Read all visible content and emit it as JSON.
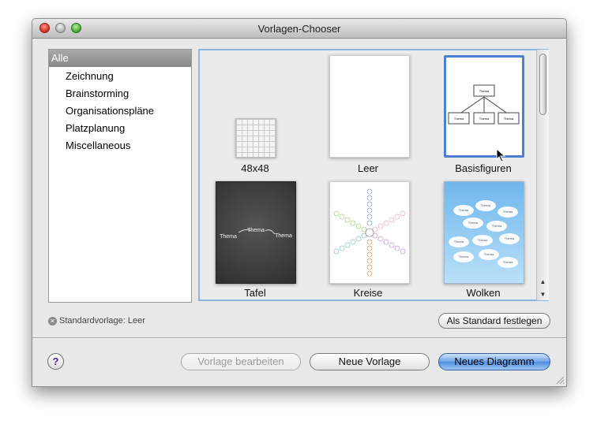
{
  "window": {
    "title": "Vorlagen-Chooser"
  },
  "sidebar": {
    "selected": "Alle",
    "items": [
      "Zeichnung",
      "Brainstorming",
      "Organisationspläne",
      "Platzplanung",
      "Miscellaneous"
    ]
  },
  "templates": [
    {
      "label": "48x48"
    },
    {
      "label": "Leer"
    },
    {
      "label": "Basisfiguren",
      "selected": true,
      "node_text": "Thema"
    },
    {
      "label": "Tafel",
      "node_text": "Thema"
    },
    {
      "label": "Kreise"
    },
    {
      "label": "Wolken",
      "node_text": "Thema"
    }
  ],
  "status": {
    "default_template": "Standardvorlage: Leer"
  },
  "buttons": {
    "set_default": "Als Standard festlegen",
    "edit_template": "Vorlage bearbeiten",
    "new_template": "Neue Vorlage",
    "new_diagram": "Neues Diagramm",
    "help": "?"
  },
  "colors": {
    "selection_blue": "#4a7fd4",
    "primary_button": "#6ea3e8",
    "chalkboard": "#3b3b3b",
    "sky": "#8ccaf2"
  },
  "icons": [
    "close-button",
    "minimize-button",
    "zoom-button",
    "clear-icon",
    "help-icon",
    "mouse-cursor",
    "resize-grip"
  ]
}
